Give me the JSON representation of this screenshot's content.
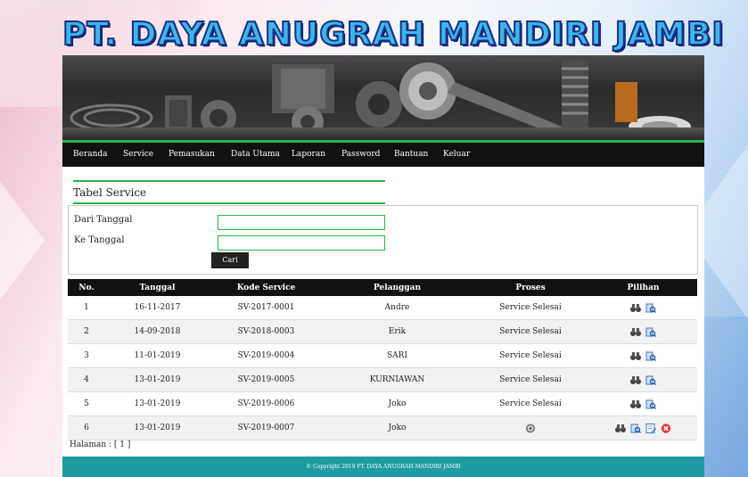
{
  "site": {
    "title": "PT. DAYA ANUGRAH MANDIRI JAMBI"
  },
  "nav": [
    "Beranda",
    "Service",
    "Pemasukan",
    "Data Utama",
    "Laporan",
    "Password",
    "Bantuan",
    "Keluar"
  ],
  "page": {
    "title": "Tabel Service"
  },
  "filter": {
    "from_label": "Dari Tanggal",
    "to_label": "Ke Tanggal",
    "from_value": "",
    "to_value": "",
    "button": "Cari"
  },
  "table": {
    "headers": [
      "No.",
      "Tanggal",
      "Kode Service",
      "Pelanggan",
      "Proses",
      "Pilihan"
    ],
    "rows": [
      {
        "no": "1",
        "tanggal": "16-11-2017",
        "kode": "SV-2017-0001",
        "pelanggan": "Andre",
        "proses": "Service Selesai"
      },
      {
        "no": "2",
        "tanggal": "14-09-2018",
        "kode": "SV-2018-0003",
        "pelanggan": "Erik",
        "proses": "Service Selesai"
      },
      {
        "no": "3",
        "tanggal": "11-01-2019",
        "kode": "SV-2019-0004",
        "pelanggan": "SARI",
        "proses": "Service Selesai"
      },
      {
        "no": "4",
        "tanggal": "13-01-2019",
        "kode": "SV-2019-0005",
        "pelanggan": "KURNIAWAN",
        "proses": "Service Selesai"
      },
      {
        "no": "5",
        "tanggal": "13-01-2019",
        "kode": "SV-2019-0006",
        "pelanggan": "Joko",
        "proses": "Service Selesai"
      },
      {
        "no": "6",
        "tanggal": "13-01-2019",
        "kode": "SV-2019-0007",
        "pelanggan": "Joko",
        "proses": ""
      }
    ]
  },
  "pagination": "Halaman : [ 1 ]",
  "footer": "© Copyright 2019 PT. DAYA ANUGRAH MANDIRI JAMBI",
  "colors": {
    "accent": "#2db24a",
    "footer": "#1e9aa0",
    "nav": "#111111"
  }
}
